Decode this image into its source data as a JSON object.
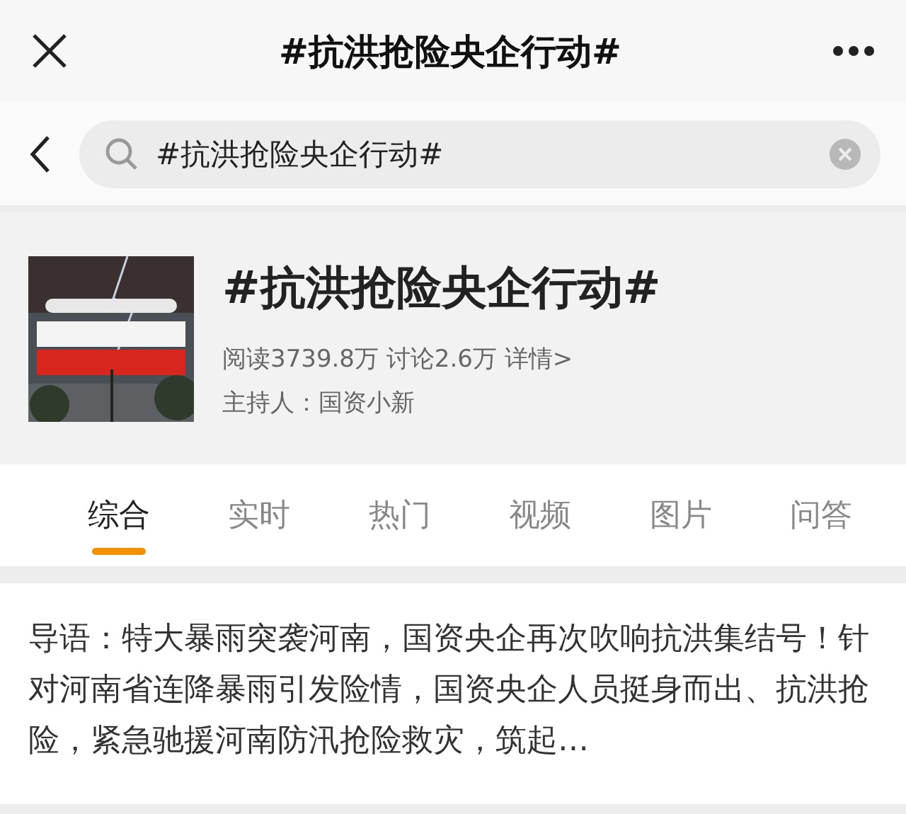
{
  "header": {
    "title": "#抗洪抢险央企行动#"
  },
  "search": {
    "value": "#抗洪抢险央企行动#"
  },
  "topic": {
    "title": "#抗洪抢险央企行动#",
    "stats": "阅读3739.8万 讨论2.6万 详情>",
    "host": "主持人：国资小新"
  },
  "tabs": [
    {
      "label": "综合",
      "selected": true
    },
    {
      "label": "实时",
      "selected": false
    },
    {
      "label": "热门",
      "selected": false
    },
    {
      "label": "视频",
      "selected": false
    },
    {
      "label": "图片",
      "selected": false
    },
    {
      "label": "问答",
      "selected": false
    }
  ],
  "intro": "导语：特大暴雨突袭河南，国资央企再次吹响抗洪集结号！针对河南省连降暴雨引发险情，国资央企人员挺身而出、抗洪抢险，紧急驰援河南防汛抢险救灾，筑起…"
}
